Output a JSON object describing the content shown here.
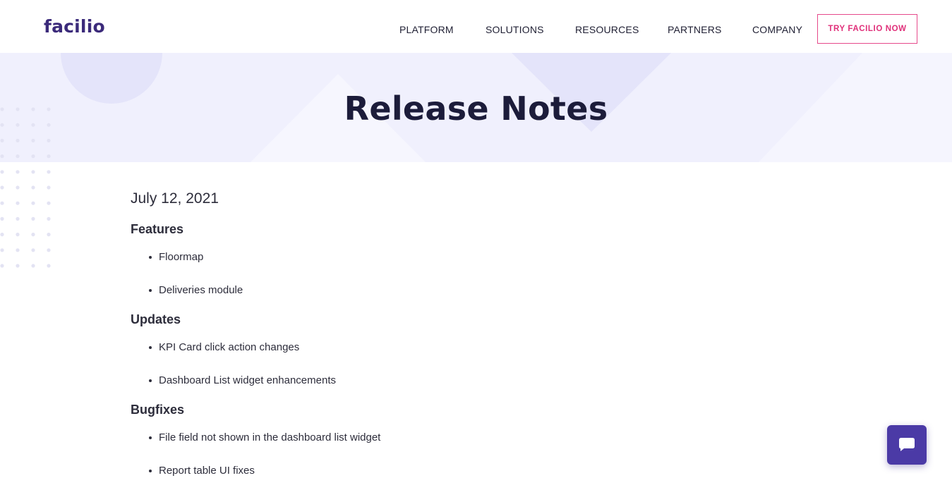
{
  "brand": {
    "logo_text": "facilio"
  },
  "nav": {
    "items": [
      {
        "label": "PLATFORM"
      },
      {
        "label": "SOLUTIONS"
      },
      {
        "label": "RESOURCES"
      },
      {
        "label": "PARTNERS"
      },
      {
        "label": "COMPANY"
      }
    ],
    "cta_label": "TRY FACILIO NOW"
  },
  "hero": {
    "title": "Release Notes"
  },
  "release": {
    "date": "July 12, 2021",
    "sections": [
      {
        "title": "Features",
        "items": [
          "Floormap",
          "Deliveries module"
        ]
      },
      {
        "title": "Updates",
        "items": [
          "KPI Card click action changes",
          "Dashboard List widget enhancements"
        ]
      },
      {
        "title": "Bugfixes",
        "items": [
          "File field not shown in the dashboard list widget",
          "Report table UI fixes"
        ]
      }
    ]
  },
  "chat_widget": {
    "icon": "chat-bubble-icon"
  },
  "colors": {
    "brand": "#3b2a7a",
    "cta": "#e0307a",
    "hero_bg": "#f0f0fd",
    "chat_bg": "#4b3aa6",
    "heading": "#1c1c3a"
  }
}
